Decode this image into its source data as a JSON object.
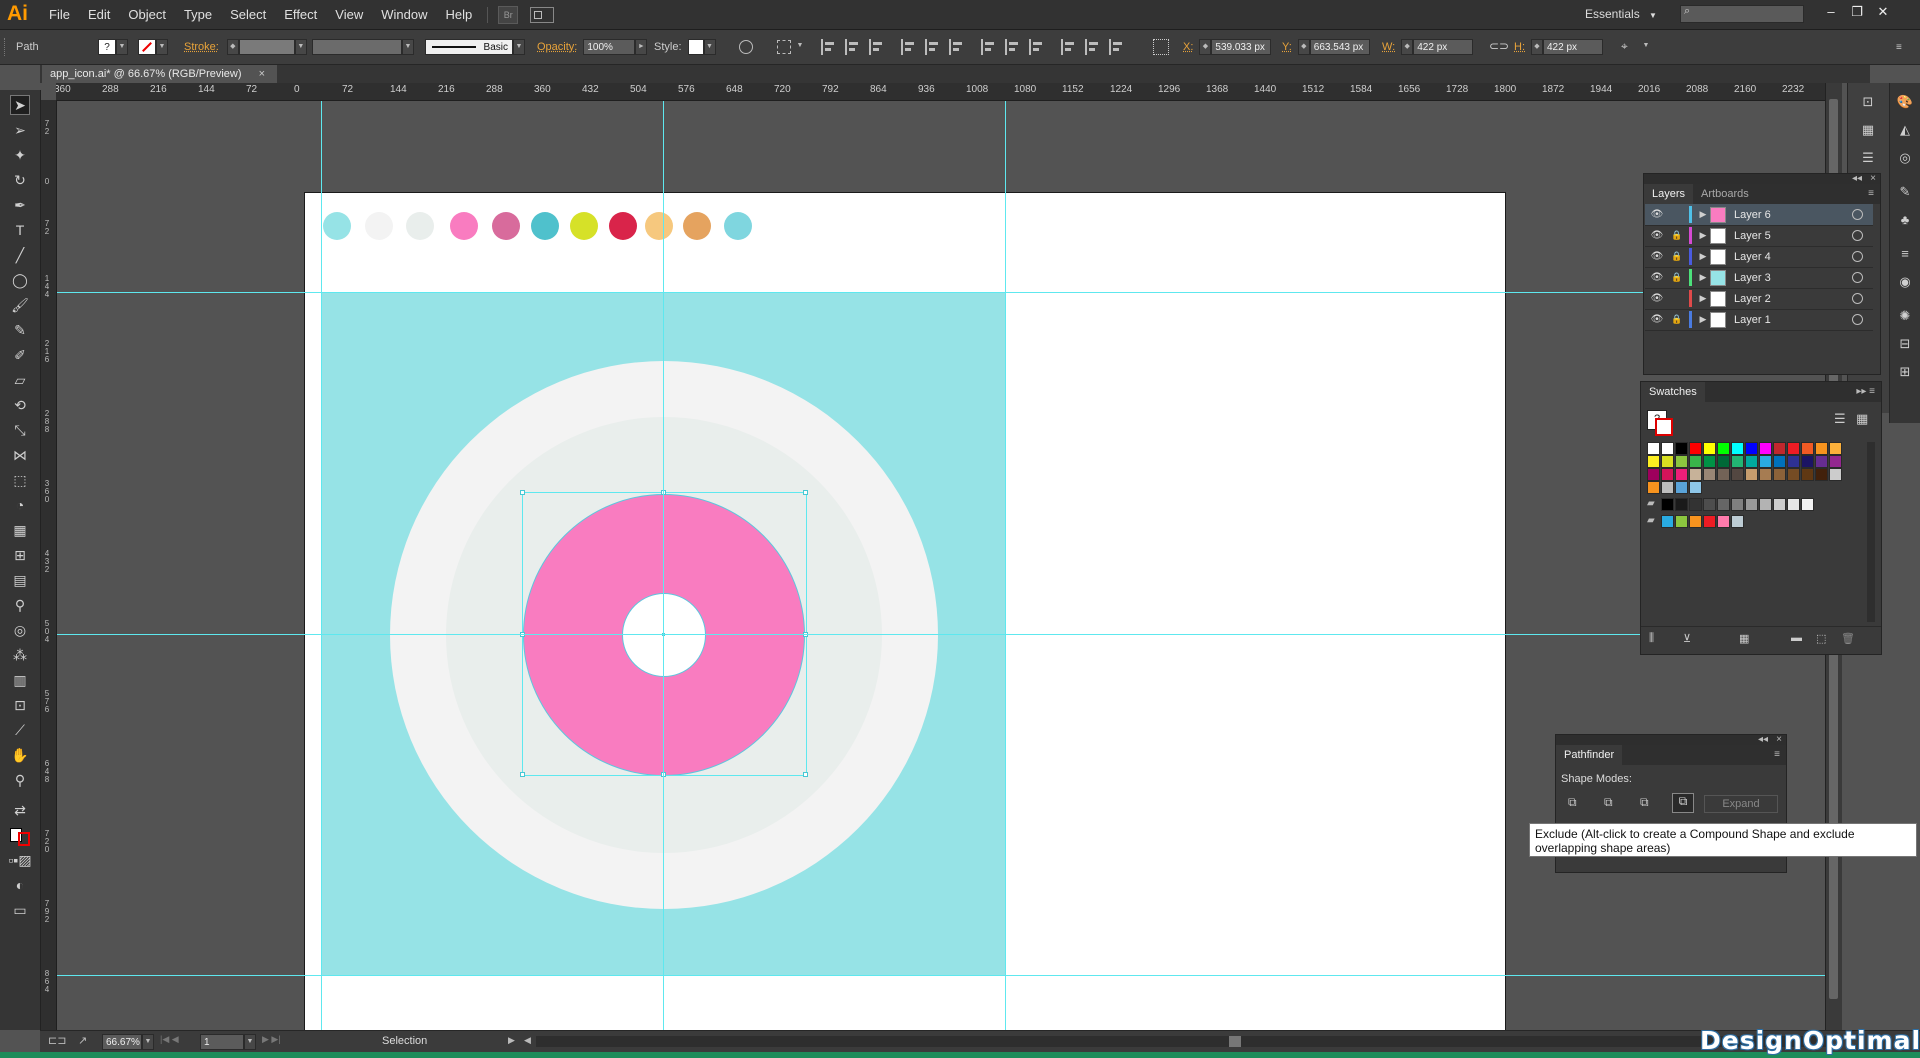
{
  "app": {
    "logo": "Ai",
    "menus": [
      "File",
      "Edit",
      "Object",
      "Type",
      "Select",
      "Effect",
      "View",
      "Window",
      "Help"
    ],
    "bridge_label": "Br",
    "workspace": "Essentials"
  },
  "control_bar": {
    "selection_type": "Path",
    "stroke_label": "Stroke:",
    "brush_label": "Basic",
    "opacity_label": "Opacity:",
    "opacity_value": "100%",
    "style_label": "Style:",
    "x_label": "X:",
    "x_value": "539.033 px",
    "y_label": "Y:",
    "y_value": "663.543 px",
    "w_label": "W:",
    "w_value": "422 px",
    "h_label": "H:",
    "h_value": "422 px"
  },
  "document": {
    "tab_title": "app_icon.ai* @ 66.67% (RGB/Preview)",
    "close_glyph": "×"
  },
  "ruler": {
    "h_ticks": [
      "360",
      "288",
      "216",
      "144",
      "72",
      "0",
      "72",
      "144",
      "216",
      "288",
      "360",
      "432",
      "504",
      "576",
      "648",
      "720",
      "792",
      "864",
      "936",
      "1008",
      "1080",
      "1152",
      "1224",
      "1296",
      "1368",
      "1440",
      "1512",
      "1584",
      "1656",
      "1728",
      "1800",
      "1872",
      "1944",
      "2016",
      "2088",
      "2160",
      "2232"
    ]
  },
  "artboard": {
    "palette_colors": [
      "#96e3e6",
      "#f3f3f3",
      "#e9eeec",
      "#f97cc0",
      "#d86b9c",
      "#4fc1cc",
      "#d6e128",
      "#d9244a",
      "#f6c87e",
      "#e5a35f",
      "#7fd6df"
    ],
    "colors": {
      "background": "#96e3e6",
      "outer_ring": "#f3f3f3",
      "inner_ring": "#e9eeec",
      "donut": "#f97cc0",
      "guide": "#5ee8ef"
    }
  },
  "layers_panel": {
    "tabs": [
      "Layers",
      "Artboards"
    ],
    "layers": [
      {
        "name": "Layer 6",
        "color": "#4fc1e9",
        "selected": true,
        "locked": false,
        "thumb": "#f97cc0"
      },
      {
        "name": "Layer 5",
        "color": "#d64ad3",
        "selected": false,
        "locked": true,
        "thumb": "#ffffff"
      },
      {
        "name": "Layer 4",
        "color": "#4a5be0",
        "selected": false,
        "locked": true,
        "thumb": "#ffffff"
      },
      {
        "name": "Layer 3",
        "color": "#4ce07a",
        "selected": false,
        "locked": true,
        "thumb": "#96e3e6"
      },
      {
        "name": "Layer 2",
        "color": "#e04a4a",
        "selected": false,
        "locked": false,
        "thumb": "#ffffff"
      },
      {
        "name": "Layer 1",
        "color": "#4a7be0",
        "selected": false,
        "locked": true,
        "thumb": "#ffffff"
      }
    ]
  },
  "swatches_panel": {
    "title": "Swatches",
    "rows": [
      [
        "#ffffff",
        "#ffffff",
        "#000000",
        "#ff0000",
        "#ffff00",
        "#00ff00",
        "#00ffff",
        "#0000ff",
        "#ff00ff",
        "#c1272d",
        "#ed1c24",
        "#f15a24",
        "#f7931e",
        "#fbb03b"
      ],
      [
        "#fcee21",
        "#d9e021",
        "#8cc63f",
        "#39b54a",
        "#009245",
        "#006837",
        "#22b573",
        "#00a99d",
        "#29abe2",
        "#0071bc",
        "#2e3192",
        "#1b1464",
        "#662d91",
        "#93278f"
      ],
      [
        "#9e005d",
        "#d4145a",
        "#ed1e79",
        "#c7b299",
        "#998675",
        "#736357",
        "#534741",
        "#c69c6d",
        "#a67c52",
        "#8c6239",
        "#754c24",
        "#603813",
        "#42210b",
        "#cccccc"
      ],
      [
        "#f7931e",
        "#bdbdbd",
        "#5aa3d8",
        "#8ec6e8"
      ],
      [
        "#000000",
        "#1a1a1a",
        "#333333",
        "#4d4d4d",
        "#666666",
        "#808080",
        "#999999",
        "#b3b3b3",
        "#cccccc",
        "#e6e6e6",
        "#f2f2f2"
      ],
      [
        "#29abe2",
        "#8cc63f",
        "#f7931e",
        "#ed1c24",
        "#ff7bac",
        "#bdccd4"
      ]
    ]
  },
  "pathfinder_panel": {
    "title": "Pathfinder",
    "shape_modes_label": "Shape Modes:",
    "expand_label": "Expand"
  },
  "tooltip": {
    "text": "Exclude (Alt-click to create a Compound Shape and exclude overlapping shape areas)"
  },
  "status_bar": {
    "zoom": "66.67%",
    "artboard_number": "1",
    "tool_name": "Selection"
  },
  "watermark": "DesignOptimal.com"
}
